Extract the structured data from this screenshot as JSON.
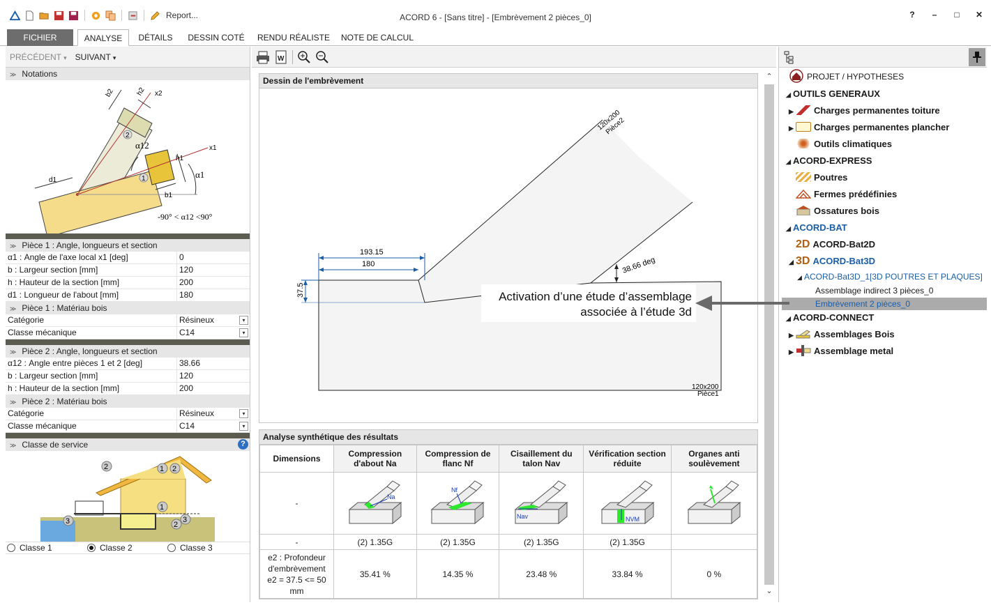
{
  "window": {
    "title": "ACORD 6 - [Sans titre] - [Embrèvement 2 pièces_0]",
    "report_label": "Report...",
    "help_glyph": "?",
    "minimize_glyph": "–",
    "maximize_glyph": "□",
    "close_glyph": "✕"
  },
  "ribbon": {
    "tabs": [
      "FICHIER",
      "ANALYSE",
      "DÉTAILS",
      "DESSIN COTÉ",
      "RENDU RÉALISTE",
      "NOTE DE CALCUL"
    ],
    "active": "ANALYSE"
  },
  "left": {
    "prev_label": "PRÉCÉDENT",
    "next_label": "SUIVANT",
    "notations_title": "Notations",
    "notation_labels": {
      "b2": "b2",
      "h2": "h2",
      "x2": "x2",
      "x1": "x1",
      "h1": "h1",
      "d1": "d1",
      "b1": "b1",
      "a12": "α12",
      "a1": "α1",
      "n1": "1",
      "n2": "2",
      "range": "-90° < α12 <90°"
    },
    "piece1_geom_title": "Pièce 1 : Angle, longueurs et section",
    "piece1_geom": [
      {
        "label": "α1 : Angle de l'axe local x1  [deg]",
        "value": "0"
      },
      {
        "label": "b : Largeur section  [mm]",
        "value": "120"
      },
      {
        "label": "h : Hauteur de la section  [mm]",
        "value": "200"
      },
      {
        "label": "d1 : Longueur de l'about  [mm]",
        "value": "180"
      }
    ],
    "piece1_mat_title": "Pièce 1 : Matériau bois",
    "piece1_mat": [
      {
        "label": "Catégorie",
        "value": "Résineux"
      },
      {
        "label": "Classe mécanique",
        "value": "C14"
      }
    ],
    "piece2_geom_title": "Pièce 2 : Angle, longueurs et section",
    "piece2_geom": [
      {
        "label": "α12 : Angle entre pièces 1 et 2  [deg]",
        "value": "38.66"
      },
      {
        "label": "b : Largeur section  [mm]",
        "value": "120"
      },
      {
        "label": "h : Hauteur de la section  [mm]",
        "value": "200"
      }
    ],
    "piece2_mat_title": "Pièce 2 : Matériau bois",
    "piece2_mat": [
      {
        "label": "Catégorie",
        "value": "Résineux"
      },
      {
        "label": "Classe mécanique",
        "value": "C14"
      }
    ],
    "service_title": "Classe de service",
    "service_help": "?",
    "service_numbers": {
      "n1": "1",
      "n2": "2",
      "n3": "3"
    },
    "service_classes": [
      "Classe 1",
      "Classe 2",
      "Classe 3"
    ],
    "service_selected": 1,
    "dropdown_glyph": "▾"
  },
  "center": {
    "drawing_title": "Dessin de l'embrèvement",
    "drawing": {
      "dim_193": "193.15",
      "dim_180": "180",
      "dim_37": "37.5",
      "angle": "38.66 deg",
      "piece2_section": "120x200",
      "piece2_name": "Pièce2",
      "piece1_section": "120x200",
      "piece1_name": "Pièce1"
    },
    "results_title": "Analyse synthétique des résultats",
    "results": {
      "headers": [
        "Dimensions",
        "Compression d'about Na",
        "Compression de flanc Nf",
        "Cisaillement du talon Nav",
        "Vérification section réduite",
        "Organes anti soulèvement"
      ],
      "icon_labels": [
        "Na",
        "Nf",
        "Nav",
        "NVM"
      ],
      "row_dash": "-",
      "combo_row": [
        "-",
        "(2) 1.35G",
        "(2) 1.35G",
        "(2) 1.35G",
        "(2) 1.35G",
        ""
      ],
      "ratio_row": {
        "label": "e2 : Profondeur d'embrèvement e2 = 37.5 <= 50 mm",
        "values": [
          "35.41 %",
          "14.35 %",
          "23.48 %",
          "33.84 %",
          "0 %"
        ]
      }
    },
    "scroll_up": "⌃",
    "scroll_down": "⌄"
  },
  "callout": {
    "line1": "Activation d’une étude d’assemblage",
    "line2": "associée à l’étude 3d"
  },
  "tree": {
    "pin_glyph": "✎",
    "items": [
      {
        "label": "PROJET / HYPOTHESES",
        "icon": "house-icon"
      },
      {
        "label": "OUTILS GENERAUX"
      },
      {
        "label": "Charges permanentes toiture",
        "icon": "roof-load-icon"
      },
      {
        "label": "Charges permanentes plancher",
        "icon": "floor-load-icon"
      },
      {
        "label": "Outils climatiques",
        "icon": "snow-icon"
      },
      {
        "label": "ACORD-EXPRESS"
      },
      {
        "label": "Poutres",
        "icon": "beam-icon"
      },
      {
        "label": "Fermes prédéfinies",
        "icon": "truss-icon"
      },
      {
        "label": "Ossatures bois",
        "icon": "frame-icon"
      },
      {
        "label": "ACORD-BAT"
      },
      {
        "label": "ACORD-Bat2D",
        "prefix": "2D"
      },
      {
        "label": "ACORD-Bat3D",
        "prefix": "3D"
      },
      {
        "label": "ACORD-Bat3D_1[3D POUTRES ET PLAQUES]"
      },
      {
        "label": "Assemblage indirect 3 pièces_0"
      },
      {
        "label": "Embrèvement 2 pièces_0"
      },
      {
        "label": "ACORD-CONNECT"
      },
      {
        "label": "Assemblages Bois",
        "icon": "wood-joint-icon"
      },
      {
        "label": "Assemblage metal",
        "icon": "metal-joint-icon"
      }
    ]
  },
  "colors": {
    "accent_blue": "#1a5ea8",
    "wood": "#f4dc8a",
    "wood_dark": "#e8c43a",
    "green": "#2ee82e",
    "arrow_gray": "#6a6a6a"
  }
}
